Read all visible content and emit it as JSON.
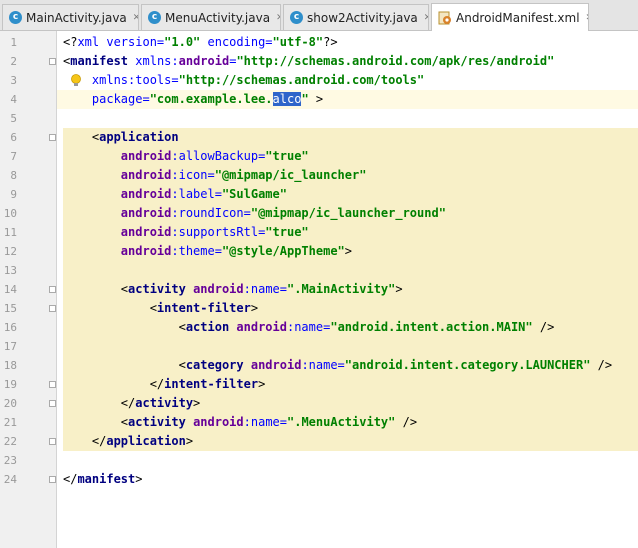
{
  "tabs": [
    {
      "label": "MainActivity.java",
      "icon": "java-class-icon",
      "icon_glyph": "c",
      "active": false
    },
    {
      "label": "MenuActivity.java",
      "icon": "java-class-icon",
      "icon_glyph": "c",
      "active": false
    },
    {
      "label": "show2Activity.java",
      "icon": "java-class-icon",
      "icon_glyph": "c",
      "active": false
    },
    {
      "label": "AndroidManifest.xml",
      "icon": "xml-file-icon",
      "active": true
    }
  ],
  "close_glyph": "✕",
  "line_numbers": [
    "1",
    "2",
    "3",
    "4",
    "5",
    "6",
    "7",
    "8",
    "9",
    "10",
    "11",
    "12",
    "13",
    "14",
    "15",
    "16",
    "17",
    "18",
    "19",
    "20",
    "21",
    "22",
    "23",
    "24"
  ],
  "code_lines": [
    [
      {
        "t": "<?",
        "c": "plain"
      },
      {
        "t": "xml version=",
        "c": "attr"
      },
      {
        "t": "\"1.0\"",
        "c": "str"
      },
      {
        "t": " encoding=",
        "c": "attr"
      },
      {
        "t": "\"utf-8\"",
        "c": "str"
      },
      {
        "t": "?>",
        "c": "plain"
      }
    ],
    [
      {
        "t": "<",
        "c": "plain"
      },
      {
        "t": "manifest ",
        "c": "tag"
      },
      {
        "t": "xmlns:",
        "c": "attr"
      },
      {
        "t": "android",
        "c": "ns"
      },
      {
        "t": "=",
        "c": "attr"
      },
      {
        "t": "\"http://schemas.android.com/apk/res/android\"",
        "c": "str"
      }
    ],
    [
      {
        "t": "    xmlns:tools=",
        "c": "attr"
      },
      {
        "t": "\"http://schemas.android.com/tools\"",
        "c": "str"
      }
    ],
    [
      {
        "t": "    package=",
        "c": "attr"
      },
      {
        "t": "\"com.example.lee.",
        "c": "str"
      },
      {
        "t": "alco",
        "c": "selected"
      },
      {
        "t": "\"",
        "c": "str"
      },
      {
        "t": " >",
        "c": "plain"
      }
    ],
    [],
    [
      {
        "t": "    <",
        "c": "plain"
      },
      {
        "t": "application",
        "c": "tag"
      }
    ],
    [
      {
        "t": "        android",
        "c": "ns"
      },
      {
        "t": ":allowBackup=",
        "c": "attr"
      },
      {
        "t": "\"true\"",
        "c": "str"
      }
    ],
    [
      {
        "t": "        android",
        "c": "ns"
      },
      {
        "t": ":icon=",
        "c": "attr"
      },
      {
        "t": "\"@mipmap/ic_launcher\"",
        "c": "str"
      }
    ],
    [
      {
        "t": "        android",
        "c": "ns"
      },
      {
        "t": ":label=",
        "c": "attr"
      },
      {
        "t": "\"SulGame\"",
        "c": "str"
      }
    ],
    [
      {
        "t": "        android",
        "c": "ns"
      },
      {
        "t": ":roundIcon=",
        "c": "attr"
      },
      {
        "t": "\"@mipmap/ic_launcher_round\"",
        "c": "str"
      }
    ],
    [
      {
        "t": "        android",
        "c": "ns"
      },
      {
        "t": ":supportsRtl=",
        "c": "attr"
      },
      {
        "t": "\"true\"",
        "c": "str"
      }
    ],
    [
      {
        "t": "        android",
        "c": "ns"
      },
      {
        "t": ":theme=",
        "c": "attr"
      },
      {
        "t": "\"@style/AppTheme\"",
        "c": "str"
      },
      {
        "t": ">",
        "c": "plain"
      }
    ],
    [],
    [
      {
        "t": "        <",
        "c": "plain"
      },
      {
        "t": "activity ",
        "c": "tag"
      },
      {
        "t": "android",
        "c": "ns"
      },
      {
        "t": ":name=",
        "c": "attr"
      },
      {
        "t": "\".MainActivity\"",
        "c": "str"
      },
      {
        "t": ">",
        "c": "plain"
      }
    ],
    [
      {
        "t": "            <",
        "c": "plain"
      },
      {
        "t": "intent-filter",
        "c": "tag"
      },
      {
        "t": ">",
        "c": "plain"
      }
    ],
    [
      {
        "t": "                <",
        "c": "plain"
      },
      {
        "t": "action ",
        "c": "tag"
      },
      {
        "t": "android",
        "c": "ns"
      },
      {
        "t": ":name=",
        "c": "attr"
      },
      {
        "t": "\"android.intent.action.MAIN\"",
        "c": "str"
      },
      {
        "t": " />",
        "c": "plain"
      }
    ],
    [],
    [
      {
        "t": "                <",
        "c": "plain"
      },
      {
        "t": "category ",
        "c": "tag"
      },
      {
        "t": "android",
        "c": "ns"
      },
      {
        "t": ":name=",
        "c": "attr"
      },
      {
        "t": "\"android.intent.category.LAUNCHER\"",
        "c": "str"
      },
      {
        "t": " />",
        "c": "plain"
      }
    ],
    [
      {
        "t": "            </",
        "c": "plain"
      },
      {
        "t": "intent-filter",
        "c": "tag"
      },
      {
        "t": ">",
        "c": "plain"
      }
    ],
    [
      {
        "t": "        </",
        "c": "plain"
      },
      {
        "t": "activity",
        "c": "tag"
      },
      {
        "t": ">",
        "c": "plain"
      }
    ],
    [
      {
        "t": "        <",
        "c": "plain"
      },
      {
        "t": "activity ",
        "c": "tag"
      },
      {
        "t": "android",
        "c": "ns"
      },
      {
        "t": ":name=",
        "c": "attr"
      },
      {
        "t": "\".MenuActivity\"",
        "c": "str"
      },
      {
        "t": " />",
        "c": "plain"
      }
    ],
    [
      {
        "t": "    </",
        "c": "plain"
      },
      {
        "t": "application",
        "c": "tag"
      },
      {
        "t": ">",
        "c": "plain"
      }
    ],
    [],
    [
      {
        "t": "</",
        "c": "plain"
      },
      {
        "t": "manifest",
        "c": "tag"
      },
      {
        "t": ">",
        "c": "plain"
      }
    ]
  ],
  "colors": {
    "string": "#008000",
    "attribute": "#0000ff",
    "namespace": "#660099",
    "tag": "#000080",
    "selection": "#2f65ca",
    "block_highlight": "#f8f0c8"
  }
}
